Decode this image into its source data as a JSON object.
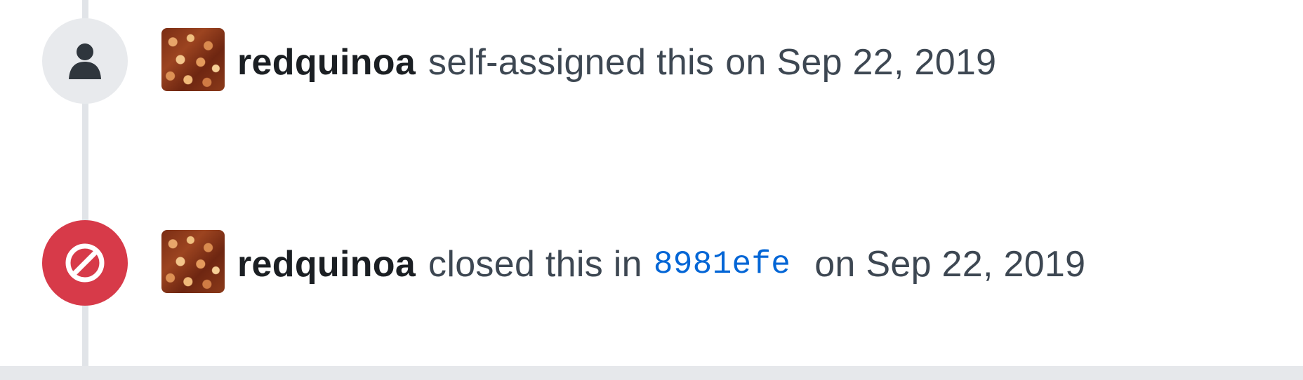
{
  "timeline": {
    "events": [
      {
        "icon": "person-icon",
        "badge_color": "#e8eaed",
        "author": "redquinoa",
        "action": "self-assigned this",
        "date": "on Sep 22, 2019"
      },
      {
        "icon": "closed-circle-slash-icon",
        "badge_color": "#d73a49",
        "author": "redquinoa",
        "action": "closed this in",
        "commit": "8981efe",
        "date": "on Sep 22, 2019"
      }
    ]
  },
  "colors": {
    "author": "#1b1f23",
    "text": "#3d4752",
    "link": "#0366d6",
    "closed": "#d73a49",
    "timeline": "#e1e4e8"
  }
}
